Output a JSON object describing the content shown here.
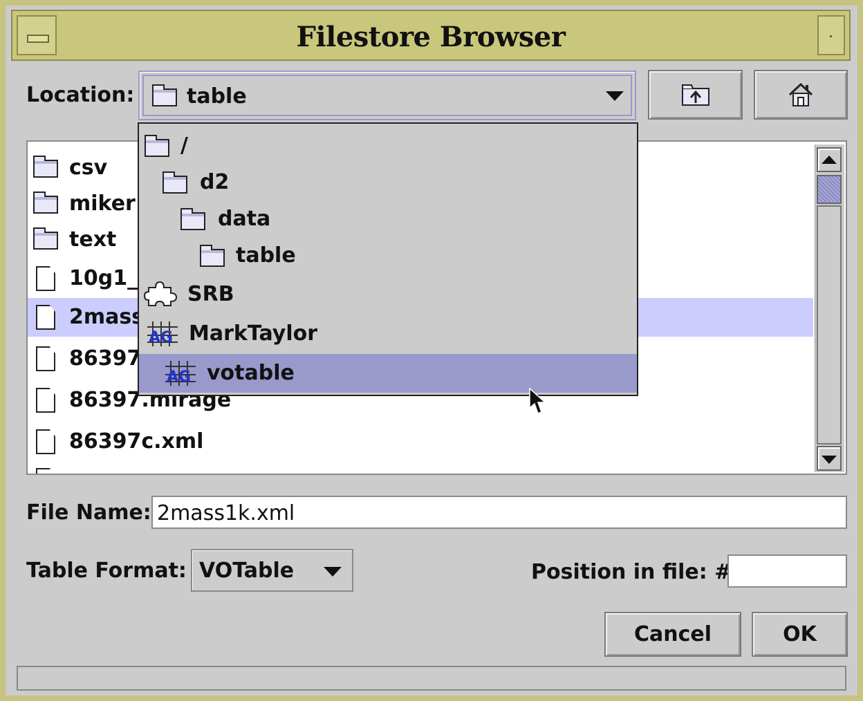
{
  "window": {
    "title": "Filestore Browser"
  },
  "location": {
    "label": "Location:",
    "value": "table"
  },
  "popup_items": [
    {
      "label": "/",
      "icon": "folder-icon"
    },
    {
      "label": "d2",
      "icon": "folder-icon"
    },
    {
      "label": "data",
      "icon": "folder-icon"
    },
    {
      "label": "table",
      "icon": "folder-icon"
    },
    {
      "label": "SRB",
      "icon": "puzzle-icon"
    },
    {
      "label": "MarkTaylor",
      "icon": "astrogrid-icon"
    },
    {
      "label": "votable",
      "icon": "astrogrid-icon"
    }
  ],
  "file_list": [
    {
      "name": "csv",
      "type": "folder"
    },
    {
      "name": "miker",
      "type": "folder"
    },
    {
      "name": "text",
      "type": "folder"
    },
    {
      "name": "10g1_",
      "type": "file"
    },
    {
      "name": "2mass",
      "type": "file",
      "selected": true
    },
    {
      "name": "86397",
      "type": "file"
    },
    {
      "name": "86397.mirage",
      "type": "file"
    },
    {
      "name": "86397c.xml",
      "type": "file"
    }
  ],
  "filename": {
    "label": "File Name:",
    "value": "2mass1k.xml"
  },
  "format": {
    "label": "Table Format:",
    "value": "VOTable"
  },
  "position": {
    "label": "Position in file: #",
    "value": ""
  },
  "buttons": {
    "cancel": "Cancel",
    "ok": "OK"
  },
  "colors": {
    "titlebar": "#c9c77c",
    "selection": "#ccccff",
    "popup_selection": "#9999cc"
  }
}
